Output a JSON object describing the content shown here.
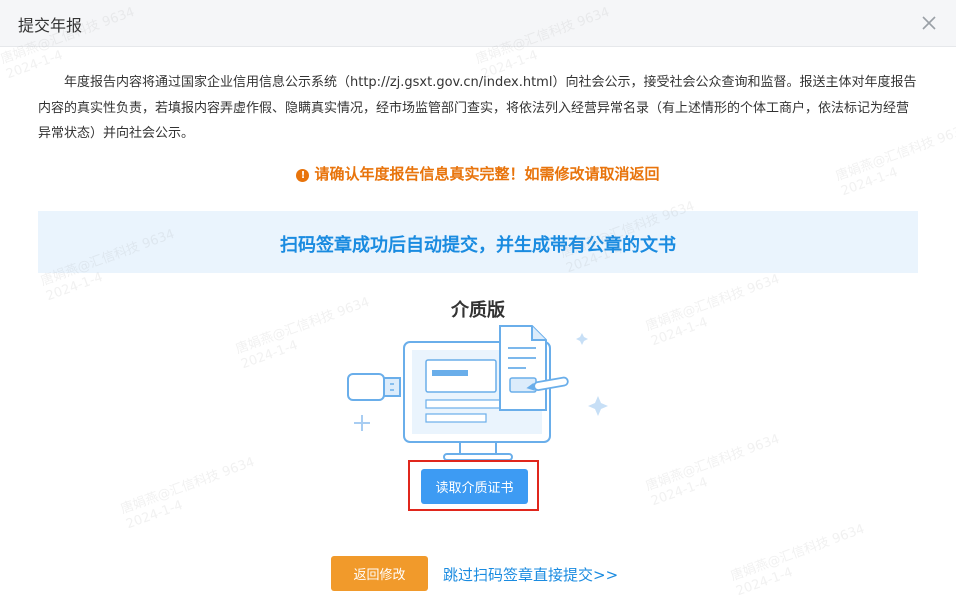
{
  "dialog": {
    "title": "提交年报",
    "close_icon": "close-icon"
  },
  "description": "年度报告内容将通过国家企业信用信息公示系统（http://zj.gsxt.gov.cn/index.html）向社会公示，接受社会公众查询和监督。报送主体对年度报告内容的真实性负责，若填报内容弄虚作假、隐瞒真实情况，经市场监管部门查实，将依法列入经营异常名录（有上述情形的个体工商户，依法标记为经营异常状态）并向社会公示。",
  "warning": {
    "icon": "!",
    "text": "请确认年度报告信息真实完整！如需修改请取消返回",
    "color": "#e8740c"
  },
  "banner": {
    "text": "扫码签章成功后自动提交，并生成带有公章的文书",
    "color": "#1a8be0",
    "background": "#eaf4fd"
  },
  "media": {
    "title": "介质版",
    "illustration": "computer-document-usb-illustration",
    "read_button": "读取介质证书"
  },
  "footer": {
    "back_button": "返回修改",
    "skip_link": "跳过扫码签章直接提交>>"
  },
  "watermark": {
    "line1": "唐娟燕@汇信科技 9634",
    "line2": "2024-1-4"
  },
  "colors": {
    "primary": "#3d9bf3",
    "orange": "#f19a2b",
    "highlight": "#e0261c"
  }
}
